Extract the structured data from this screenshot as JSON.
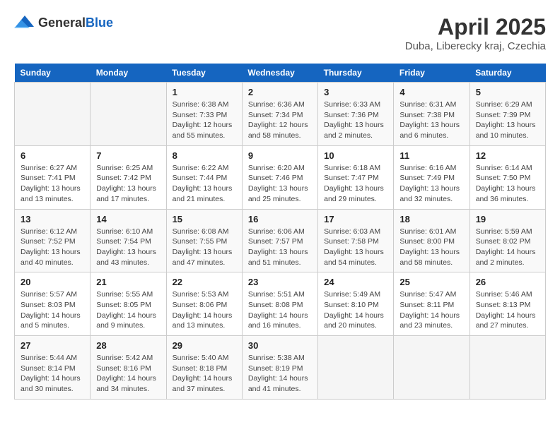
{
  "header": {
    "logo_general": "General",
    "logo_blue": "Blue",
    "title": "April 2025",
    "subtitle": "Duba, Liberecky kraj, Czechia"
  },
  "calendar": {
    "columns": [
      "Sunday",
      "Monday",
      "Tuesday",
      "Wednesday",
      "Thursday",
      "Friday",
      "Saturday"
    ],
    "rows": [
      [
        {
          "day": "",
          "info": ""
        },
        {
          "day": "",
          "info": ""
        },
        {
          "day": "1",
          "info": "Sunrise: 6:38 AM\nSunset: 7:33 PM\nDaylight: 12 hours\nand 55 minutes."
        },
        {
          "day": "2",
          "info": "Sunrise: 6:36 AM\nSunset: 7:34 PM\nDaylight: 12 hours\nand 58 minutes."
        },
        {
          "day": "3",
          "info": "Sunrise: 6:33 AM\nSunset: 7:36 PM\nDaylight: 13 hours\nand 2 minutes."
        },
        {
          "day": "4",
          "info": "Sunrise: 6:31 AM\nSunset: 7:38 PM\nDaylight: 13 hours\nand 6 minutes."
        },
        {
          "day": "5",
          "info": "Sunrise: 6:29 AM\nSunset: 7:39 PM\nDaylight: 13 hours\nand 10 minutes."
        }
      ],
      [
        {
          "day": "6",
          "info": "Sunrise: 6:27 AM\nSunset: 7:41 PM\nDaylight: 13 hours\nand 13 minutes."
        },
        {
          "day": "7",
          "info": "Sunrise: 6:25 AM\nSunset: 7:42 PM\nDaylight: 13 hours\nand 17 minutes."
        },
        {
          "day": "8",
          "info": "Sunrise: 6:22 AM\nSunset: 7:44 PM\nDaylight: 13 hours\nand 21 minutes."
        },
        {
          "day": "9",
          "info": "Sunrise: 6:20 AM\nSunset: 7:46 PM\nDaylight: 13 hours\nand 25 minutes."
        },
        {
          "day": "10",
          "info": "Sunrise: 6:18 AM\nSunset: 7:47 PM\nDaylight: 13 hours\nand 29 minutes."
        },
        {
          "day": "11",
          "info": "Sunrise: 6:16 AM\nSunset: 7:49 PM\nDaylight: 13 hours\nand 32 minutes."
        },
        {
          "day": "12",
          "info": "Sunrise: 6:14 AM\nSunset: 7:50 PM\nDaylight: 13 hours\nand 36 minutes."
        }
      ],
      [
        {
          "day": "13",
          "info": "Sunrise: 6:12 AM\nSunset: 7:52 PM\nDaylight: 13 hours\nand 40 minutes."
        },
        {
          "day": "14",
          "info": "Sunrise: 6:10 AM\nSunset: 7:54 PM\nDaylight: 13 hours\nand 43 minutes."
        },
        {
          "day": "15",
          "info": "Sunrise: 6:08 AM\nSunset: 7:55 PM\nDaylight: 13 hours\nand 47 minutes."
        },
        {
          "day": "16",
          "info": "Sunrise: 6:06 AM\nSunset: 7:57 PM\nDaylight: 13 hours\nand 51 minutes."
        },
        {
          "day": "17",
          "info": "Sunrise: 6:03 AM\nSunset: 7:58 PM\nDaylight: 13 hours\nand 54 minutes."
        },
        {
          "day": "18",
          "info": "Sunrise: 6:01 AM\nSunset: 8:00 PM\nDaylight: 13 hours\nand 58 minutes."
        },
        {
          "day": "19",
          "info": "Sunrise: 5:59 AM\nSunset: 8:02 PM\nDaylight: 14 hours\nand 2 minutes."
        }
      ],
      [
        {
          "day": "20",
          "info": "Sunrise: 5:57 AM\nSunset: 8:03 PM\nDaylight: 14 hours\nand 5 minutes."
        },
        {
          "day": "21",
          "info": "Sunrise: 5:55 AM\nSunset: 8:05 PM\nDaylight: 14 hours\nand 9 minutes."
        },
        {
          "day": "22",
          "info": "Sunrise: 5:53 AM\nSunset: 8:06 PM\nDaylight: 14 hours\nand 13 minutes."
        },
        {
          "day": "23",
          "info": "Sunrise: 5:51 AM\nSunset: 8:08 PM\nDaylight: 14 hours\nand 16 minutes."
        },
        {
          "day": "24",
          "info": "Sunrise: 5:49 AM\nSunset: 8:10 PM\nDaylight: 14 hours\nand 20 minutes."
        },
        {
          "day": "25",
          "info": "Sunrise: 5:47 AM\nSunset: 8:11 PM\nDaylight: 14 hours\nand 23 minutes."
        },
        {
          "day": "26",
          "info": "Sunrise: 5:46 AM\nSunset: 8:13 PM\nDaylight: 14 hours\nand 27 minutes."
        }
      ],
      [
        {
          "day": "27",
          "info": "Sunrise: 5:44 AM\nSunset: 8:14 PM\nDaylight: 14 hours\nand 30 minutes."
        },
        {
          "day": "28",
          "info": "Sunrise: 5:42 AM\nSunset: 8:16 PM\nDaylight: 14 hours\nand 34 minutes."
        },
        {
          "day": "29",
          "info": "Sunrise: 5:40 AM\nSunset: 8:18 PM\nDaylight: 14 hours\nand 37 minutes."
        },
        {
          "day": "30",
          "info": "Sunrise: 5:38 AM\nSunset: 8:19 PM\nDaylight: 14 hours\nand 41 minutes."
        },
        {
          "day": "",
          "info": ""
        },
        {
          "day": "",
          "info": ""
        },
        {
          "day": "",
          "info": ""
        }
      ]
    ]
  }
}
